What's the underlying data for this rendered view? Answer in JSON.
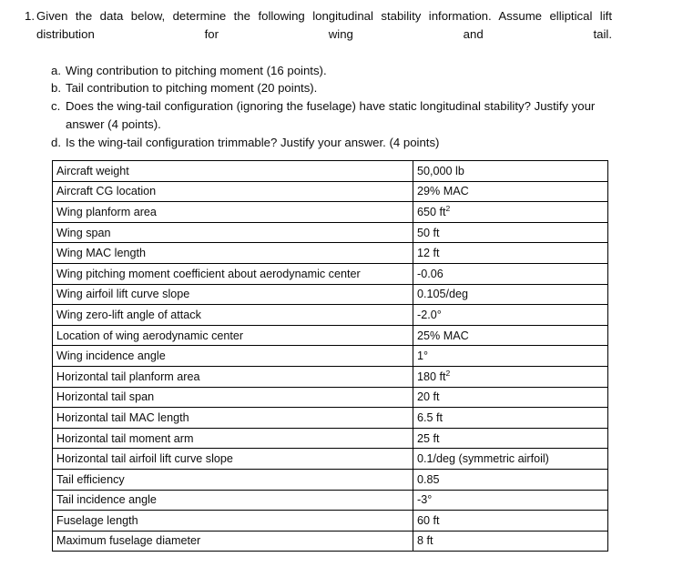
{
  "question": {
    "number": "1.",
    "intro": "Given the data below, determine the following longitudinal stability information. Assume elliptical lift distribution for wing and tail.",
    "sub_items": [
      {
        "marker": "a.",
        "text": "Wing contribution to pitching moment (16 points)."
      },
      {
        "marker": "b.",
        "text": "Tail contribution to pitching moment (20 points)."
      },
      {
        "marker": "c.",
        "text": "Does the wing-tail configuration (ignoring the fuselage) have static longitudinal stability? Justify your answer (4 points)."
      },
      {
        "marker": "d.",
        "text": "Is the wing-tail configuration trimmable? Justify your answer. (4 points)"
      }
    ]
  },
  "data_table": {
    "rows": [
      {
        "parameter": "Aircraft weight",
        "value": "50,000 lb",
        "value_sup": ""
      },
      {
        "parameter": "Aircraft CG location",
        "value": "29% MAC",
        "value_sup": ""
      },
      {
        "parameter": "Wing planform area",
        "value": "650 ft",
        "value_sup": "2"
      },
      {
        "parameter": "Wing span",
        "value": "50 ft",
        "value_sup": ""
      },
      {
        "parameter": "Wing MAC length",
        "value": "12 ft",
        "value_sup": ""
      },
      {
        "parameter": "Wing pitching moment coefficient about aerodynamic center",
        "value": "-0.06",
        "value_sup": ""
      },
      {
        "parameter": "Wing airfoil lift curve slope",
        "value": "0.105/deg",
        "value_sup": ""
      },
      {
        "parameter": "Wing zero-lift angle of attack",
        "value": "-2.0°",
        "value_sup": ""
      },
      {
        "parameter": "Location of wing aerodynamic center",
        "value": "25% MAC",
        "value_sup": ""
      },
      {
        "parameter": "Wing incidence angle",
        "value": "1°",
        "value_sup": ""
      },
      {
        "parameter": "Horizontal tail planform area",
        "value": "180 ft",
        "value_sup": "2"
      },
      {
        "parameter": "Horizontal tail span",
        "value": "20 ft",
        "value_sup": ""
      },
      {
        "parameter": "Horizontal tail MAC length",
        "value": "6.5 ft",
        "value_sup": ""
      },
      {
        "parameter": "Horizontal tail moment arm",
        "value": "25 ft",
        "value_sup": ""
      },
      {
        "parameter": "Horizontal tail airfoil lift curve slope",
        "value": "0.1/deg (symmetric airfoil)",
        "value_sup": ""
      },
      {
        "parameter": "Tail efficiency",
        "value": "0.85",
        "value_sup": ""
      },
      {
        "parameter": "Tail incidence angle",
        "value": "-3°",
        "value_sup": ""
      },
      {
        "parameter": "Fuselage length",
        "value": "60 ft",
        "value_sup": ""
      },
      {
        "parameter": "Maximum fuselage diameter",
        "value": "8 ft",
        "value_sup": ""
      }
    ]
  }
}
